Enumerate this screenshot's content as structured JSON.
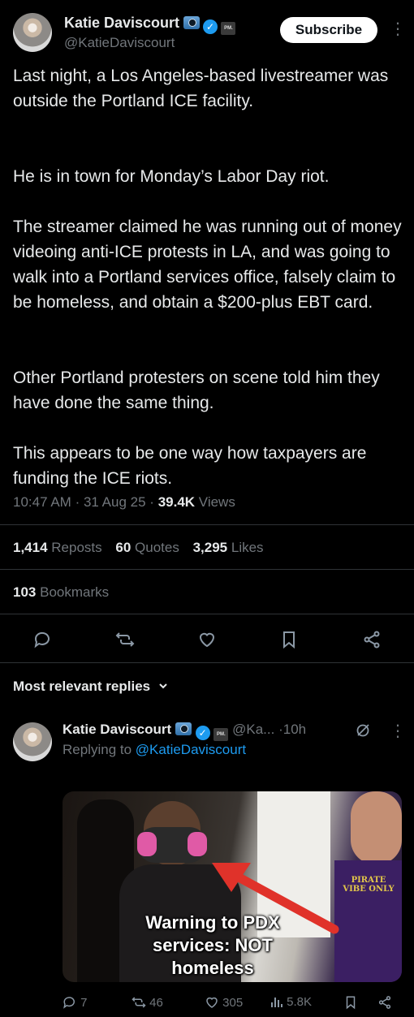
{
  "post": {
    "author_name": "Katie Daviscourt",
    "author_handle": "@KatieDaviscourt",
    "pm_badge": "PM.",
    "subscribe_label": "Subscribe",
    "more_label": "⋮",
    "paragraphs": [
      "Last night, a Los Angeles-based livestreamer was outside the Portland ICE facility.",
      "He is in town for Monday’s Labor Day riot.",
      "The streamer claimed he was running out of money videoing anti-ICE protests in LA, and was going to walk into a Portland services office, falsely claim to be homeless, and obtain a $200-plus EBT card.",
      "Other Portland protesters on scene told him they have done the same thing.",
      "This appears to be one way how taxpayers are funding the ICE riots."
    ],
    "time": "10:47 AM",
    "date": "31 Aug 25",
    "views_count": "39.4K",
    "views_label": "Views",
    "reposts_count": "1,414",
    "reposts_label": "Reposts",
    "quotes_count": "60",
    "quotes_label": "Quotes",
    "likes_count": "3,295",
    "likes_label": "Likes",
    "bookmarks_count": "103",
    "bookmarks_label": "Bookmarks"
  },
  "actions": [
    "reply-icon",
    "repost-icon",
    "like-icon",
    "bookmark-icon",
    "share-icon"
  ],
  "replies_sort_label": "Most relevant replies",
  "reply": {
    "author_name": "Katie Daviscourt",
    "pm_badge": "PM.",
    "handle_truncated": "@Ka...",
    "age": "10h",
    "replying_prefix": "Replying to",
    "replying_handle": "@KatieDaviscourt",
    "media_caption_line1": "Warning to PDX",
    "media_caption_line2": "services: NOT",
    "media_caption_line3": "homeless",
    "media_sign_text": "PIRATE VIBE ONLY",
    "reply_count": "7",
    "repost_count": "46",
    "like_count": "305",
    "views_count": "5.8K"
  },
  "colors": {
    "background": "#000000",
    "text": "#e7e9ea",
    "muted": "#71767b",
    "link": "#1d9bf0",
    "arrow": "#e0322a"
  }
}
